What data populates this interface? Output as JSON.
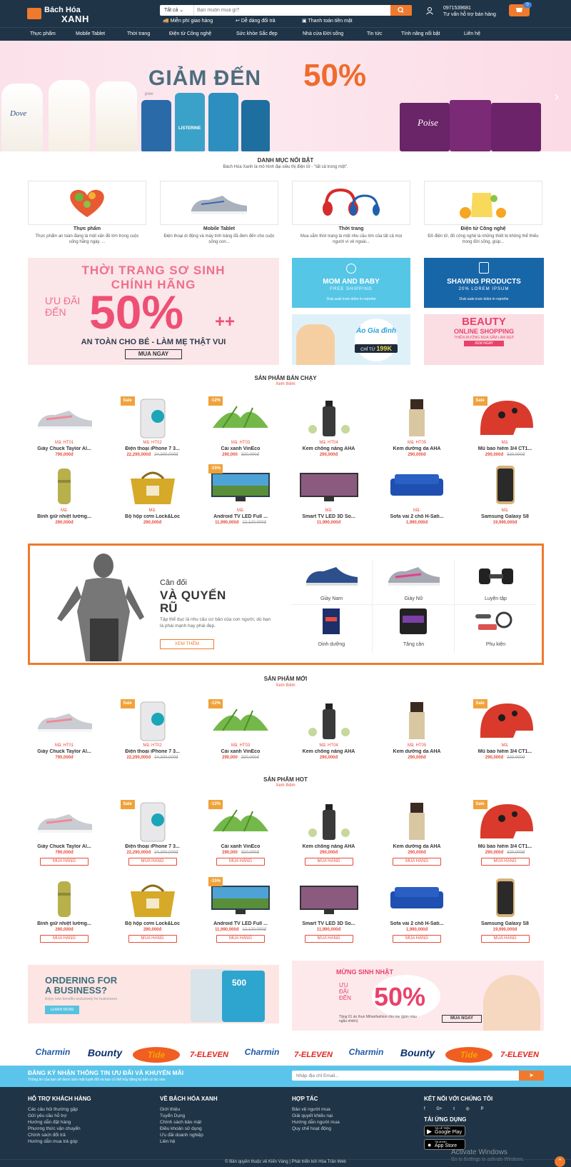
{
  "header": {
    "logo_line1": "Bách Hóa",
    "logo_line2": "XANH",
    "search_category": "Tất cả",
    "search_placeholder": "Bạn muốn mua gì?",
    "perks": [
      "Miễn phí giao hàng",
      "Dễ dàng đổi trả",
      "Thanh toán tiền mặt"
    ],
    "phone": "0971539681",
    "support": "Tư vấn hỗ trợ bán hàng",
    "cart_count": "0"
  },
  "nav": [
    "Thực phẩm",
    "Mobile Tablet",
    "Thời trang",
    "Điện tử Công nghệ",
    "Sức khỏe Sắc đẹp",
    "Nhà cửa Đời sống",
    "Tin tức",
    "Tính năng nổi bật",
    "Liên hệ"
  ],
  "banner": {
    "text": "GIẢM ĐẾN",
    "percent": "50%",
    "brand_left": "Dove",
    "brand_mid": "LISTERINE",
    "brand_right": "Poise",
    "small_logo": "prev"
  },
  "featured": {
    "title": "DANH MỤC NỔI BẬT",
    "desc": "Bách Hóa Xanh là mô hình đại siêu thị điện tử - \"tất cả trong một\".",
    "cards": [
      {
        "name": "Thực phẩm",
        "desc": "Thực phẩm an toàn đang là một vấn đề lớn trong cuộc sống hằng ngày. ..."
      },
      {
        "name": "Mobile Tablet",
        "desc": "Điện thoại di động và máy tính bảng đã đem đến cho cuộc sống con..."
      },
      {
        "name": "Thời trang",
        "desc": "Mua sắm thời trang là một nhu cầu lớn của tất cả mọi người vì vẻ ngoài..."
      },
      {
        "name": "Điện tử Công nghệ",
        "desc": "Đồ điện tử, đồ công nghệ là những thiết bị không thể thiếu trong đời sống, giúp..."
      }
    ]
  },
  "promos": {
    "big_line1": "THỜI TRANG SƠ SINH",
    "big_line2": "CHÍNH HÃNG",
    "big_offer": "ƯU ĐÃI",
    "big_offer2": "ĐẾN",
    "big_pct": "50%",
    "big_plus": "++",
    "big_sub": "AN TOÀN CHO BÉ - LÀM MẸ THẬT VUI",
    "big_btn": "MUA NGAY",
    "mom_title": "MOM AND BABY",
    "mom_sub": "FREE SHIPPING",
    "mom_small": "Duis aute irure dolor in reprehe",
    "shave_title": "SHAVING PRODUCTS",
    "shave_sub": "20% LOREM IPSUM",
    "shave_small": "Duis aute irure dolor in reprehe",
    "family_title": "Áo Gia đình",
    "family_price_pre": "CHỈ TỪ",
    "family_price": "199K",
    "beauty_title": "BEAUTY",
    "beauty_sub": "ONLINE SHOPPING",
    "beauty_small": "THIÊN ĐƯỜNG MUA SẮM LÀM ĐẸP",
    "beauty_btn": "XEM NGAY"
  },
  "best": {
    "title": "SẢN PHẨM BÁN CHẠY",
    "more": "Xem thêm"
  },
  "products_row1": [
    {
      "code": "Mã: HT01",
      "name": "Giày Chuck Taylor Al...",
      "price": "790,000đ",
      "old": "",
      "badge": ""
    },
    {
      "code": "Mã: HT02",
      "name": "Điện thoại iPhone 7 3...",
      "price": "22,290,000đ",
      "old": "24,300,000đ",
      "badge": "Sale"
    },
    {
      "code": "Mã: HT03",
      "name": "Cải xanh VinEco",
      "price": "290,000",
      "old": "320,000đ",
      "badge": "-12%"
    },
    {
      "code": "Mã: HT04",
      "name": "Kem chống nắng AHA",
      "price": "290,000đ",
      "old": "",
      "badge": ""
    },
    {
      "code": "Mã: HT05",
      "name": "Kem dưỡng da AHA",
      "price": "290,000đ",
      "old": "",
      "badge": ""
    },
    {
      "code": "Mã:",
      "name": "Mũ bảo hiểm 3/4 CT1...",
      "price": "290,000đ",
      "old": "320,000đ",
      "badge": "Sale"
    }
  ],
  "products_row2": [
    {
      "code": "Mã:",
      "name": "Bình giữ nhiệt lường...",
      "price": "290,000đ",
      "old": "",
      "badge": ""
    },
    {
      "code": "Mã:",
      "name": "Bộ hộp cơm Lock&Loc",
      "price": "290,000đ",
      "old": "",
      "badge": ""
    },
    {
      "code": "Mã:",
      "name": "Android TV LED Full ...",
      "price": "11,990,000đ",
      "old": "12,120,000đ",
      "badge": "-15%"
    },
    {
      "code": "Mã:",
      "name": "Smart TV LED 3D So...",
      "price": "11,990,000đ",
      "old": "",
      "badge": ""
    },
    {
      "code": "Mã:",
      "name": "Sofa vải 2 chỗ H-Sati...",
      "price": "1,990,000đ",
      "old": "",
      "badge": ""
    },
    {
      "code": "Mã:",
      "name": "Samsung Galaxy S8",
      "price": "19,990,000đ",
      "old": "",
      "badge": ""
    }
  ],
  "gym": {
    "pre": "Cân đối",
    "title1": "VÀ QUYẾN",
    "title2": "RŨ",
    "desc": "Tập thể dục là nhu cầu cơ bản của con người, dù bạn là phái mạnh hay phái đẹp.",
    "btn": "XEM THÊM",
    "cats": [
      "Giày Nam",
      "Giày Nữ",
      "Luyện tập",
      "Dinh dưỡng",
      "Tăng cân",
      "Phụ kiện"
    ]
  },
  "newp": {
    "title": "SẢN PHẨM MỚI",
    "more": "Xem thêm"
  },
  "hot": {
    "title": "SẢN PHẨM HOT",
    "more": "Xem thêm",
    "buy": "MUA HÀNG"
  },
  "ads": {
    "left_title1": "ORDERING FOR",
    "left_title2": "A BUSINESS?",
    "left_sub": "Enjoy new benefits exclusively for businesses",
    "left_btn": "LEARN MORE",
    "left_num": "500",
    "right_title": "MỪNG SINH NHẬT",
    "right_offer1": "ƯU",
    "right_offer2": "ĐÃI",
    "right_offer3": "ĐẾN",
    "right_pct": "50%",
    "right_small": "Tặng 01 áo thun Mihanfashion cho mẹ (giàn màu ngẫu nhiên)",
    "right_btn": "MUA NGAY"
  },
  "brands": [
    "Charmin",
    "Bounty",
    "Tide",
    "7-ELEVEN",
    "Charmin",
    "7-ELEVEN",
    "Charmin",
    "Bounty",
    "Tide",
    "7-ELEVEN"
  ],
  "newsletter": {
    "title": "ĐĂNG KÝ NHẬN THÔNG TIN ƯU ĐÃI VÀ KHUYẾN MÃI",
    "sub": "Thông tin của bạn sẽ được bảo mật tuyệt đối và bạn có thể hủy đăng ký bất cứ lúc nào",
    "placeholder": "Nhập địa chỉ Email..."
  },
  "footer": {
    "col1_title": "HỖ TRỢ KHÁCH HÀNG",
    "col1": [
      "Các câu hỏi thường gặp",
      "Gửi yêu cầu hỗ trợ",
      "Hướng dẫn đặt hàng",
      "Phương thức vận chuyển",
      "Chính sách đổi trả",
      "Hướng dẫn mua trả góp"
    ],
    "col2_title": "VỀ BÁCH HÓA XANH",
    "col2": [
      "Giới thiệu",
      "Tuyển Dụng",
      "Chính sách bảo mật",
      "Điều khoản sử dụng",
      "Ưu đãi doanh nghiệp",
      "Liên hệ"
    ],
    "col3_title": "HỢP TÁC",
    "col3": [
      "Bảo vệ người mua",
      "Giải quyết khiếu nại",
      "Hướng dẫn người mua",
      "Quy chế hoạt động"
    ],
    "col4_title": "KẾT NỐI VỚI CHÚNG TÔI",
    "social": [
      "f",
      "G+",
      "t",
      "◎",
      "P"
    ],
    "app_title": "TẢI ỨNG DỤNG",
    "gp_small": "TẢI VỀ TRÊN",
    "gp": "Google Play",
    "as_small": "Tải về trên",
    "as": "App Store",
    "copyright": "© Bản quyền thuộc về Kiến Vàng | Phát triển bởi Hòa Trần Web",
    "watermark1": "Activate Windows",
    "watermark2": "Go to Settings to activate Windows."
  },
  "colors": {
    "accent": "#ef7a2d",
    "dark": "#1f3446",
    "price": "#e74c3c",
    "news": "#5bc4ea"
  }
}
